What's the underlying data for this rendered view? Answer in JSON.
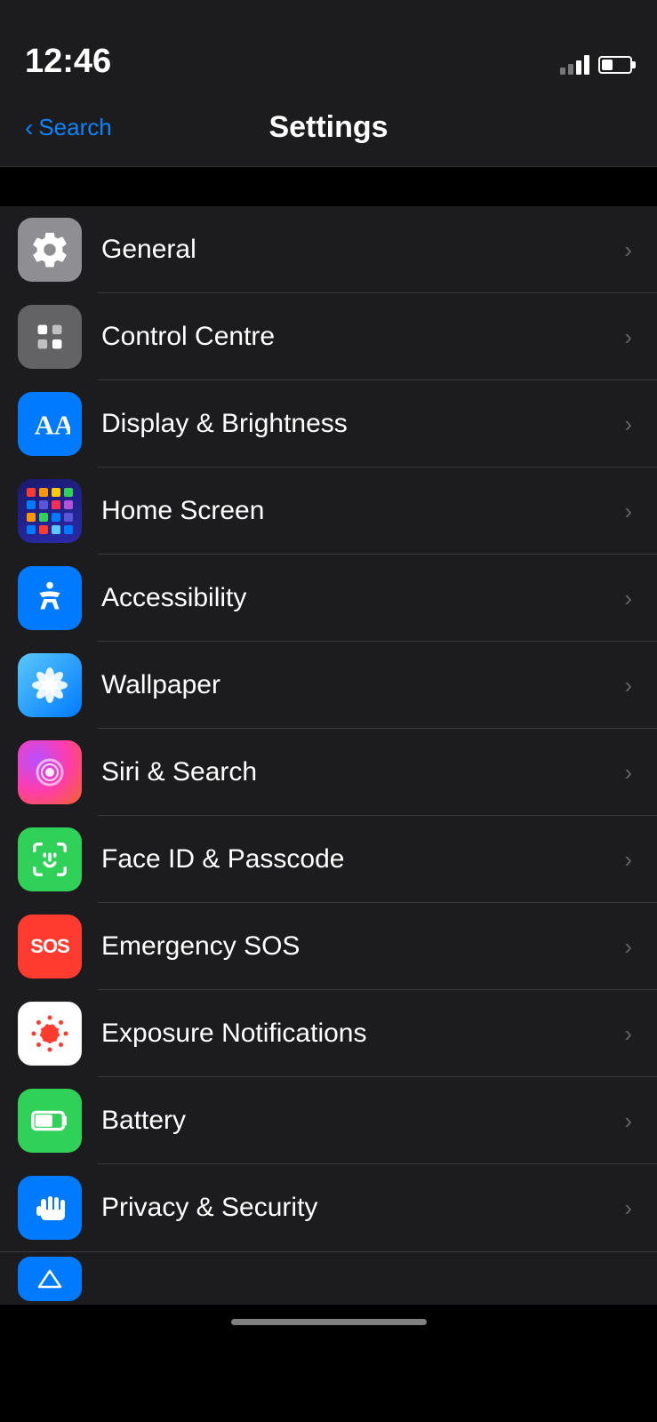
{
  "statusBar": {
    "time": "12:46",
    "backLabel": "Search"
  },
  "navTitle": "Settings",
  "settingsItems": [
    {
      "id": "general",
      "label": "General",
      "iconType": "general",
      "iconColor": "#8e8e93"
    },
    {
      "id": "control-centre",
      "label": "Control Centre",
      "iconType": "control",
      "iconColor": "#636366"
    },
    {
      "id": "display-brightness",
      "label": "Display & Brightness",
      "iconType": "display",
      "iconColor": "#007aff"
    },
    {
      "id": "home-screen",
      "label": "Home Screen",
      "iconType": "homescreen",
      "iconColor": "#1c1c8a"
    },
    {
      "id": "accessibility",
      "label": "Accessibility",
      "iconType": "accessibility",
      "iconColor": "#007aff"
    },
    {
      "id": "wallpaper",
      "label": "Wallpaper",
      "iconType": "wallpaper",
      "iconColor": "#3fa9f5"
    },
    {
      "id": "siri-search",
      "label": "Siri & Search",
      "iconType": "siri",
      "iconColor": "gradient"
    },
    {
      "id": "face-id",
      "label": "Face ID & Passcode",
      "iconType": "faceid",
      "iconColor": "#30d158"
    },
    {
      "id": "emergency-sos",
      "label": "Emergency SOS",
      "iconType": "sos",
      "iconColor": "#ff3b30"
    },
    {
      "id": "exposure",
      "label": "Exposure Notifications",
      "iconType": "exposure",
      "iconColor": "#ffffff"
    },
    {
      "id": "battery",
      "label": "Battery",
      "iconType": "battery",
      "iconColor": "#30d158"
    },
    {
      "id": "privacy",
      "label": "Privacy & Security",
      "iconType": "privacy",
      "iconColor": "#007aff"
    }
  ],
  "homescreenDotColors": [
    "#ff3b30",
    "#ff9500",
    "#ffcc00",
    "#30d158",
    "#007aff",
    "#5856d6",
    "#ff2d55",
    "#af52de",
    "#ff9500",
    "#30d158",
    "#007aff",
    "#5856d6",
    "#007aff",
    "#ff3b30",
    "#5ac8fa",
    "#007aff"
  ]
}
